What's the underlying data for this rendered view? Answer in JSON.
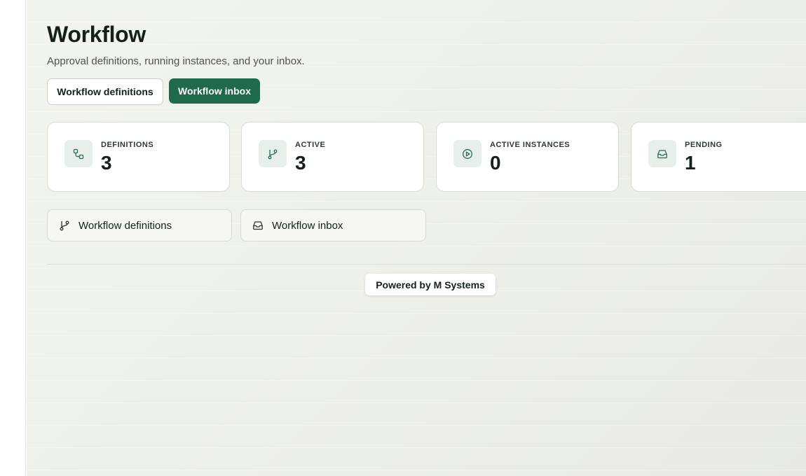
{
  "header": {
    "title": "Workflow",
    "subtitle": "Approval definitions, running instances, and your inbox."
  },
  "buttons": {
    "definitions_label": "Workflow definitions",
    "inbox_label": "Workflow inbox"
  },
  "stats": [
    {
      "label": "DEFINITIONS",
      "value": "3",
      "icon": "workflow-nodes-icon"
    },
    {
      "label": "ACTIVE",
      "value": "3",
      "icon": "branch-icon"
    },
    {
      "label": "ACTIVE INSTANCES",
      "value": "0",
      "icon": "play-circle-icon"
    },
    {
      "label": "PENDING",
      "value": "1",
      "icon": "inbox-icon"
    }
  ],
  "links": [
    {
      "label": "Workflow definitions",
      "icon": "branch-icon"
    },
    {
      "label": "Workflow inbox",
      "icon": "inbox-icon"
    }
  ],
  "footer": {
    "powered_by": "Powered by M Systems"
  },
  "colors": {
    "accent": "#1f6a4a",
    "icon_bg": "#e6efe9",
    "text": "#152019"
  }
}
